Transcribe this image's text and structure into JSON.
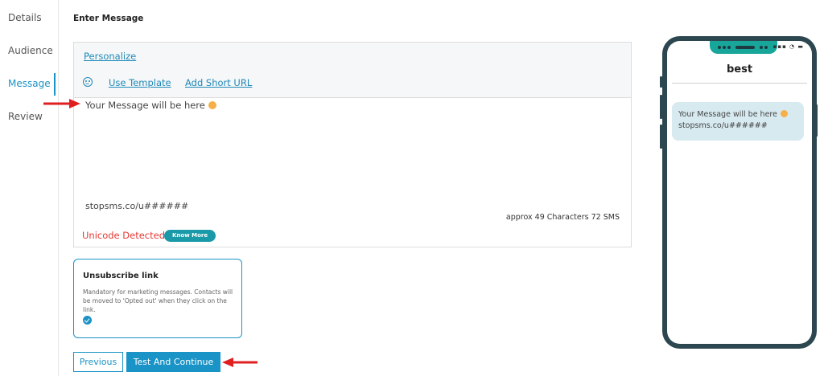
{
  "sidebar": {
    "items": [
      {
        "label": "Details",
        "active": false
      },
      {
        "label": "Audience",
        "active": false
      },
      {
        "label": "Message",
        "active": true
      },
      {
        "label": "Review",
        "active": false
      }
    ]
  },
  "main": {
    "heading": "Enter Message",
    "toolbar": {
      "personalize": "Personalize",
      "use_template": "Use Template",
      "add_short_url": "Add Short URL",
      "emoji_icon": "smiley-icon"
    },
    "message": {
      "text": "Your Message will be here",
      "short_url": "stopsms.co/u######",
      "counter": "approx 49 Characters  72 SMS"
    },
    "unicode": {
      "warning": "Unicode Detected",
      "know_more": "Know More"
    },
    "unsubscribe": {
      "title": "Unsubscribe link",
      "description": "Mandatory for marketing messages. Contacts will be moved to 'Opted out' when they click on the link.",
      "checked": true
    },
    "buttons": {
      "previous": "Previous",
      "next": "Test And Continue"
    }
  },
  "preview": {
    "sender": "best",
    "bubble_line1": "Your Message will be here",
    "bubble_line2": "stopsms.co/u######"
  },
  "colors": {
    "accent": "#1a93c6",
    "warning": "#e53935",
    "annotation_arrow": "#e02020",
    "phone_frame": "#2c4750"
  }
}
